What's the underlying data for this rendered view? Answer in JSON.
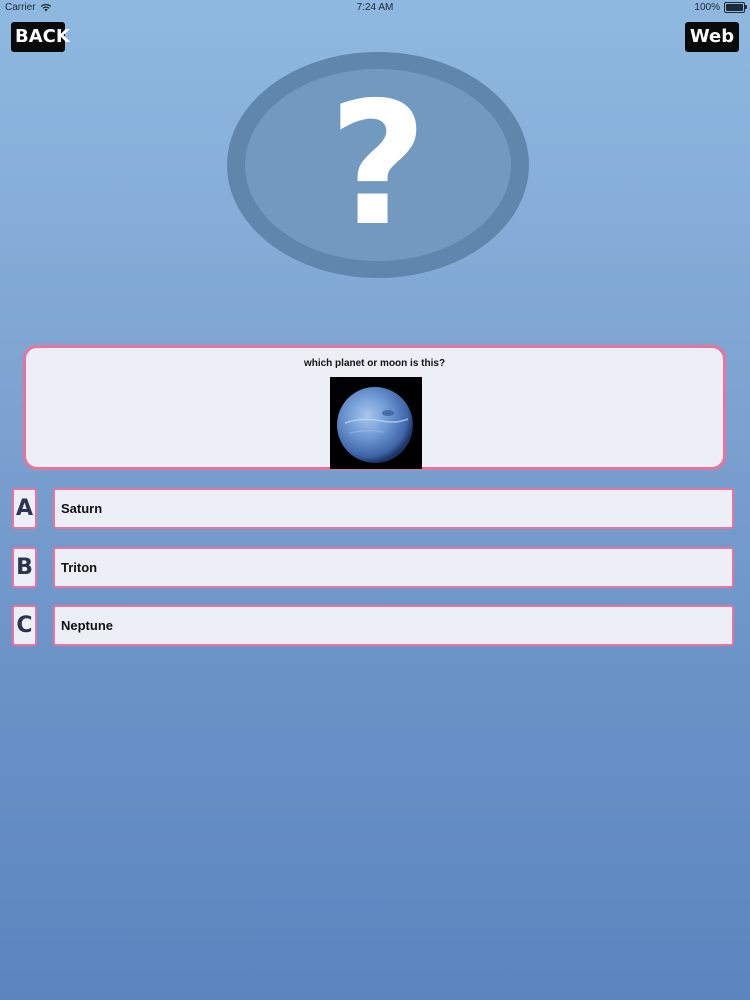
{
  "status_bar": {
    "carrier": "Carrier",
    "time": "7:24 AM",
    "battery": "100%"
  },
  "nav": {
    "back_label": "BACK",
    "web_label": "Web"
  },
  "emblem": {
    "symbol": "?"
  },
  "question": {
    "text": "which planet or moon is this?",
    "image_icon": "neptune-planet-image"
  },
  "answers": [
    {
      "letter": "A",
      "text": "Saturn"
    },
    {
      "letter": "B",
      "text": "Triton"
    },
    {
      "letter": "C",
      "text": "Neptune"
    }
  ],
  "colors": {
    "accent_border": "#e8739c",
    "card_background": "#edeff7",
    "nav_button": "#0a0a0a"
  }
}
